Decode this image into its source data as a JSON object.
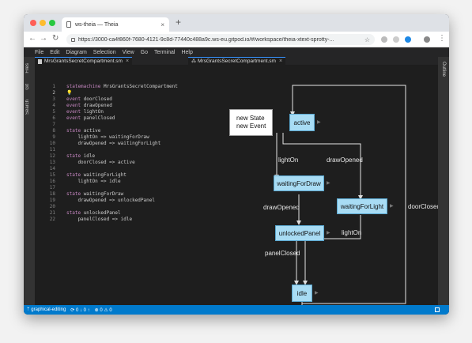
{
  "browser": {
    "tab_title": "ws-theia — Theia",
    "tab_close": "×",
    "new_tab": "+",
    "url": "https://3000-ca4f860f-7680-4121-9c8d-77440c488a9c.ws-eu.gitpod.io/#/workspace/theia-xtext-sprotty-..."
  },
  "menu": [
    "File",
    "Edit",
    "Diagram",
    "Selection",
    "View",
    "Go",
    "Terminal",
    "Help"
  ],
  "left_activity": {
    "files": "Files",
    "git": "Git",
    "search": "Search"
  },
  "right_activity": {
    "outline": "Outline"
  },
  "editor": {
    "tab_label": "MrsGrantsSecretCompartment.sm",
    "tab_close": "×",
    "lines": [
      {
        "n": "1",
        "tokens": [
          {
            "t": "statemachine ",
            "k": "kw"
          },
          {
            "t": "MrsGrantsSecretCompartment",
            "k": "ct"
          }
        ]
      },
      {
        "n": "2",
        "tokens": [
          {
            "t": "💡",
            "k": "bulb"
          }
        ]
      },
      {
        "n": "3",
        "tokens": [
          {
            "t": "event ",
            "k": "kw"
          },
          {
            "t": "doorClosed",
            "k": "ct"
          }
        ]
      },
      {
        "n": "4",
        "tokens": [
          {
            "t": "event ",
            "k": "kw"
          },
          {
            "t": "drawOpened",
            "k": "ct"
          }
        ]
      },
      {
        "n": "5",
        "tokens": [
          {
            "t": "event ",
            "k": "kw"
          },
          {
            "t": "lightOn",
            "k": "ct"
          }
        ]
      },
      {
        "n": "6",
        "tokens": [
          {
            "t": "event ",
            "k": "kw"
          },
          {
            "t": "panelClosed",
            "k": "ct"
          }
        ]
      },
      {
        "n": "7",
        "tokens": []
      },
      {
        "n": "8",
        "tokens": [
          {
            "t": "state ",
            "k": "kw"
          },
          {
            "t": "active",
            "k": "ct"
          }
        ]
      },
      {
        "n": "9",
        "tokens": [
          {
            "t": "    lightOn => waitingForDraw",
            "k": "ct"
          }
        ]
      },
      {
        "n": "10",
        "tokens": [
          {
            "t": "    drawOpened => waitingForLight",
            "k": "ct"
          }
        ]
      },
      {
        "n": "11",
        "tokens": []
      },
      {
        "n": "12",
        "tokens": [
          {
            "t": "state ",
            "k": "kw"
          },
          {
            "t": "idle",
            "k": "ct"
          }
        ]
      },
      {
        "n": "13",
        "tokens": [
          {
            "t": "    doorClosed => active",
            "k": "ct"
          }
        ]
      },
      {
        "n": "14",
        "tokens": []
      },
      {
        "n": "15",
        "tokens": [
          {
            "t": "state ",
            "k": "kw"
          },
          {
            "t": "waitingForLight",
            "k": "ct"
          }
        ]
      },
      {
        "n": "16",
        "tokens": [
          {
            "t": "    lightOn => idle",
            "k": "ct"
          }
        ]
      },
      {
        "n": "17",
        "tokens": []
      },
      {
        "n": "18",
        "tokens": [
          {
            "t": "state ",
            "k": "kw"
          },
          {
            "t": "waitingForDraw",
            "k": "ct"
          }
        ]
      },
      {
        "n": "19",
        "tokens": [
          {
            "t": "    drawOpened => unlockedPanel",
            "k": "ct"
          }
        ]
      },
      {
        "n": "20",
        "tokens": []
      },
      {
        "n": "21",
        "tokens": [
          {
            "t": "state ",
            "k": "kw"
          },
          {
            "t": "unlockedPanel",
            "k": "ct"
          }
        ]
      },
      {
        "n": "22",
        "tokens": [
          {
            "t": "    panelClosed => idle",
            "k": "ct"
          }
        ]
      }
    ]
  },
  "diagram": {
    "tab_label": "MrsGrantsSecretCompartment.sm",
    "tab_close": "×",
    "palette": {
      "new_state": "new State",
      "new_event": "new Event"
    },
    "states": {
      "active": "active",
      "waitingForDraw": "waitingForDraw",
      "waitingForLight": "waitingForLight",
      "unlockedPanel": "unlockedPanel",
      "idle": "idle"
    },
    "edges": {
      "lightOn_1": "lightOn",
      "drawOpened_1": "drawOpened",
      "drawOpened_2": "drawOpened",
      "lightOn_2": "lightOn",
      "panelClosed": "panelClosed",
      "doorClosed": "doorClosed"
    }
  },
  "status": {
    "branch": "ᛘ graphical-editing",
    "sync": "⟳ 0 ↓ 0 ↑",
    "problems": "⊗ 0 ⚠ 0"
  },
  "colors": {
    "node_fill": "#a8dcf4",
    "status_bar": "#007acc",
    "keyword": "#c586c0"
  }
}
